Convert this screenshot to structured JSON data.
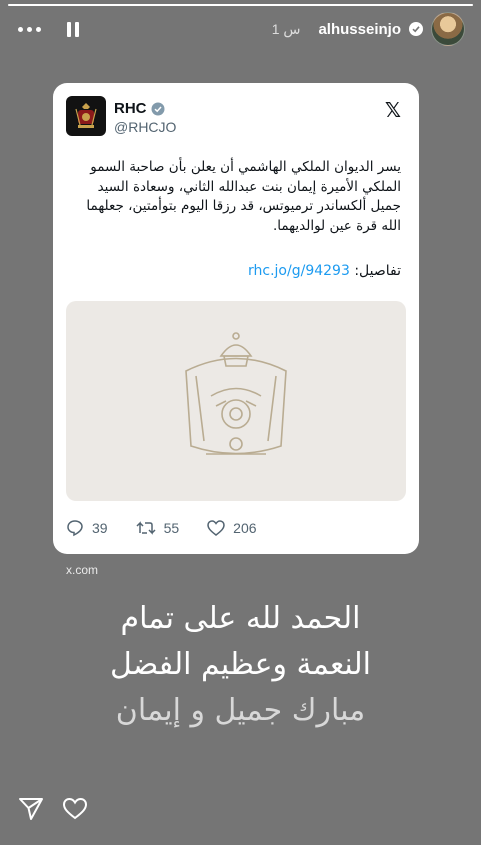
{
  "story": {
    "progress_fraction": 1.0,
    "user": {
      "username": "alhusseinjo",
      "time": "1 س"
    }
  },
  "tweet": {
    "account_name": "RHC",
    "account_handle": "@RHCJO",
    "text": "يسر الديوان الملكي الهاشمي أن يعلن بأن صاحبة السمو الملكي الأميرة إيمان بنت عبدالله الثاني، وسعادة السيد جميل ألكساندر ترميوتس، قد رزقا اليوم بتوأمتين، جعلهما الله قرة عين لوالديهما.",
    "details_label": "تفاصيل:",
    "link": "rhc.jo/g/94293",
    "replies": "39",
    "reposts": "55",
    "likes": "206"
  },
  "source_label": "x.com",
  "caption": {
    "line1": "الحمد لله على تمام",
    "line2": "النعمة وعظيم الفضل",
    "line3": "مبارك جميل و إيمان"
  },
  "colors": {
    "background": "#757575",
    "link": "#1d9bf0",
    "verified": "#829aab"
  },
  "icons": [
    "more-options-icon",
    "pause-icon",
    "verified-icon",
    "x-logo-icon",
    "reply-icon",
    "repost-icon",
    "like-icon",
    "share-icon",
    "heart-icon"
  ]
}
